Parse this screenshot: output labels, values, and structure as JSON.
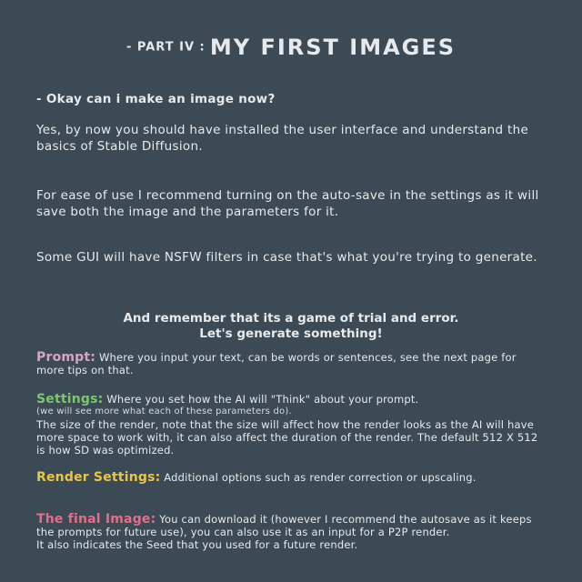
{
  "header": {
    "part": "- PART IV :",
    "title": "MY FIRST IMAGES"
  },
  "question": "- Okay can i make an image now?",
  "paragraphs": [
    "Yes, by now you should have installed the user interface and understand the basics of Stable Diffusion.",
    "For ease of use I recommend turning on the auto-save in the settings as it will save both the image and the parameters for it.",
    "Some GUI will have NSFW filters in case that's what you're trying to generate."
  ],
  "emphasis": {
    "line1": "And remember that its a game of trial and error.",
    "line2": "Let's generate something!"
  },
  "sections": {
    "prompt": {
      "label": "Prompt:",
      "color": "#d9a3c9",
      "text": "Where you input your text, can be words or sentences, see the next page for more tips on that."
    },
    "settings": {
      "label": "Settings:",
      "color": "#7cc66e",
      "text": "Where you set how the AI will \"Think\" about your prompt.",
      "small": "(we will see more what each of these parameters do).",
      "extra": "The size of the render, note that the size will affect how the render looks as the AI will have more space to work with, it can also affect the duration of the render. The default 512 X 512 is how SD was optimized."
    },
    "render": {
      "label": "Render Settings:",
      "color": "#e8c64a",
      "text": "Additional options such as render correction or upscaling."
    },
    "final": {
      "label": "The final Image:",
      "color": "#e06f8b",
      "text": "You can download it (however I recommend the autosave as it keeps the prompts for future use), you can also use it as an input for a P2P render.",
      "extra": "It also indicates the Seed that you used for a future render."
    }
  }
}
